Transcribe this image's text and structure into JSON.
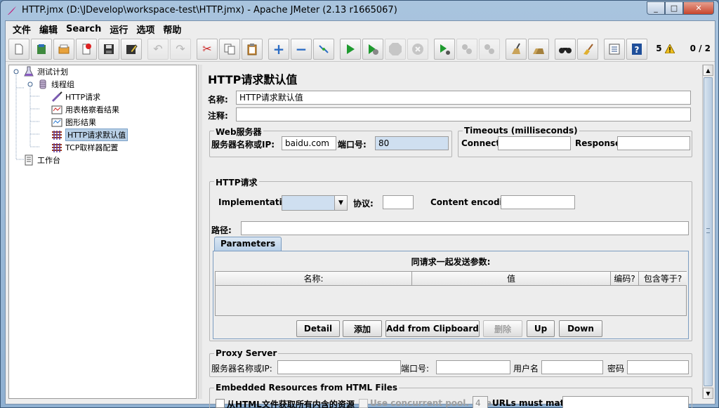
{
  "window": {
    "title": "HTTP.jmx (D:\\JDevelop\\workspace-test\\HTTP.jmx) - Apache JMeter (2.13 r1665067)",
    "controls": {
      "minimize": "_",
      "maximize": "□",
      "close": "✕"
    }
  },
  "menu": [
    "文件",
    "编辑",
    "Search",
    "运行",
    "选项",
    "帮助"
  ],
  "toolbar": {
    "buttons": [
      {
        "name": "new-icon",
        "glyph": "🗋"
      },
      {
        "name": "templates-icon",
        "glyph": "▤"
      },
      {
        "name": "open-icon",
        "glyph": "📂"
      },
      {
        "name": "close-plan-icon",
        "glyph": "⊗"
      },
      {
        "name": "save-icon",
        "glyph": "💾"
      },
      {
        "name": "save-as-icon",
        "glyph": "✎"
      },
      {
        "name": "undo-icon",
        "glyph": "↶"
      },
      {
        "name": "redo-icon",
        "glyph": "↷"
      },
      {
        "name": "cut-icon",
        "glyph": "✂"
      },
      {
        "name": "copy-icon",
        "glyph": "⧉"
      },
      {
        "name": "paste-icon",
        "glyph": "📋"
      },
      {
        "name": "expand-icon",
        "glyph": "+"
      },
      {
        "name": "collapse-icon",
        "glyph": "−"
      },
      {
        "name": "toggle-icon",
        "glyph": "⤨"
      },
      {
        "name": "start-icon",
        "glyph": "▶"
      },
      {
        "name": "start-no-pause-icon",
        "glyph": "▶"
      },
      {
        "name": "stop-icon",
        "glyph": "STOP"
      },
      {
        "name": "shutdown-icon",
        "glyph": "✕"
      },
      {
        "name": "remote-start-icon",
        "glyph": "▶"
      },
      {
        "name": "remote-stop-icon",
        "glyph": "⚫"
      },
      {
        "name": "remote-shutdown-icon",
        "glyph": "⚫"
      },
      {
        "name": "clear-icon",
        "glyph": "🧹"
      },
      {
        "name": "clear-all-icon",
        "glyph": "🧹"
      },
      {
        "name": "search-icon",
        "glyph": "🔭"
      },
      {
        "name": "reset-search-icon",
        "glyph": "🧽"
      },
      {
        "name": "function-helper-icon",
        "glyph": "☰"
      },
      {
        "name": "help-icon",
        "glyph": "?"
      }
    ],
    "error_count": "5",
    "threads": "0 / 2"
  },
  "tree": [
    {
      "label": "测试计划",
      "icon": "test-plan-icon"
    },
    {
      "label": "线程组",
      "icon": "thread-group-icon"
    },
    {
      "label": "HTTP请求",
      "icon": "http-sampler-icon"
    },
    {
      "label": "用表格察看结果",
      "icon": "table-listener-icon"
    },
    {
      "label": "图形结果",
      "icon": "graph-listener-icon"
    },
    {
      "label": "HTTP请求默认值",
      "icon": "config-element-icon"
    },
    {
      "label": "TCP取样器配置",
      "icon": "config-element-icon"
    },
    {
      "label": "工作台",
      "icon": "workbench-icon"
    }
  ],
  "panel": {
    "title": "HTTP请求默认值",
    "name_label": "名称:",
    "name_value": "HTTP请求默认值",
    "comment_label": "注释:",
    "comment_value": "",
    "web_server": {
      "group_title": "Web服务器",
      "server_label": "服务器名称或IP:",
      "server_value": "baidu.com",
      "port_label": "端口号:",
      "port_value": "80"
    },
    "timeouts": {
      "group_title": "Timeouts (milliseconds)",
      "connect_label": "Connect:",
      "connect_value": "",
      "response_label": "Response:",
      "response_value": ""
    },
    "http_request": {
      "group_title": "HTTP请求",
      "implementation_label": "Implementation:",
      "implementation_value": "",
      "protocol_label": "协议:",
      "protocol_value": "",
      "encoding_label": "Content encoding:",
      "encoding_value": "",
      "path_label": "路径:",
      "path_value": ""
    },
    "parameters": {
      "tab_label": "Parameters",
      "table_title": "同请求一起发送参数:",
      "columns": [
        "名称:",
        "值",
        "编码?",
        "包含等于?"
      ],
      "rows": [],
      "buttons": {
        "detail": "Detail",
        "add": "添加",
        "add_from_clipboard": "Add from Clipboard",
        "delete": "删除",
        "up": "Up",
        "down": "Down"
      }
    },
    "proxy": {
      "group_title": "Proxy Server",
      "server_label": "服务器名称或IP:",
      "server_value": "",
      "port_label": "端口号:",
      "port_value": "",
      "user_label": "用户名",
      "user_value": "",
      "password_label": "密码",
      "password_value": ""
    },
    "embedded": {
      "group_title": "Embedded Resources from HTML Files",
      "retrieve_label": "从HTML文件获取所有内含的资源",
      "retrieve_checked": false,
      "concurrent_label": "Use concurrent pool. Size:",
      "concurrent_checked": false,
      "pool_size": "4",
      "urls_must_match_label": "URLs must match:",
      "urls_must_match_value": ""
    }
  }
}
